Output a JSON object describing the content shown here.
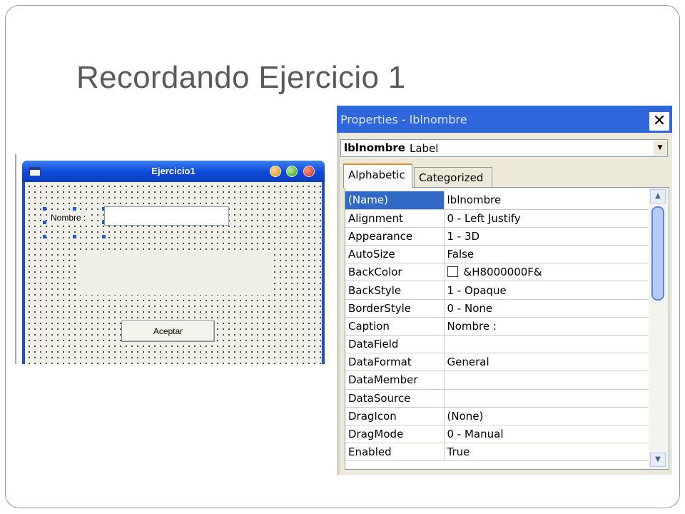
{
  "slide": {
    "title": "Recordando Ejercicio 1"
  },
  "form_window": {
    "title": "Ejercicio1",
    "label_text": "Nombre :",
    "button_label": "Aceptar"
  },
  "properties": {
    "title": "Properties - lblnombre",
    "close_glyph": "✕",
    "object_name": "lblnombre",
    "object_type": "Label",
    "tabs": [
      "Alphabetic",
      "Categorized"
    ],
    "selected_tab": "Alphabetic",
    "selected_property": "(Name)",
    "rows": [
      {
        "name": "(Name)",
        "value": "lblnombre"
      },
      {
        "name": "Alignment",
        "value": "0 - Left Justify"
      },
      {
        "name": "Appearance",
        "value": "1 - 3D"
      },
      {
        "name": "AutoSize",
        "value": "False"
      },
      {
        "name": "BackColor",
        "value": "&H8000000F&"
      },
      {
        "name": "BackStyle",
        "value": "1 - Opaque"
      },
      {
        "name": "BorderStyle",
        "value": "0 - None"
      },
      {
        "name": "Caption",
        "value": "Nombre :"
      },
      {
        "name": "DataField",
        "value": ""
      },
      {
        "name": "DataFormat",
        "value": "General"
      },
      {
        "name": "DataMember",
        "value": ""
      },
      {
        "name": "DataSource",
        "value": ""
      },
      {
        "name": "DragIcon",
        "value": "(None)"
      },
      {
        "name": "DragMode",
        "value": "0 - Manual"
      },
      {
        "name": "Enabled",
        "value": "True"
      }
    ]
  },
  "colors": {
    "title_text": "#5a5a5a",
    "xp_title_blue": "#0d49d6",
    "props_title_blue": "#2f66d9",
    "selection_blue": "#316ac5"
  },
  "icons": [
    "window-system-icon",
    "minimize-icon",
    "maximize-icon",
    "close-icon",
    "close-x-icon",
    "dropdown-arrow-icon",
    "scroll-up-icon",
    "scroll-down-icon",
    "color-swatch-icon"
  ]
}
